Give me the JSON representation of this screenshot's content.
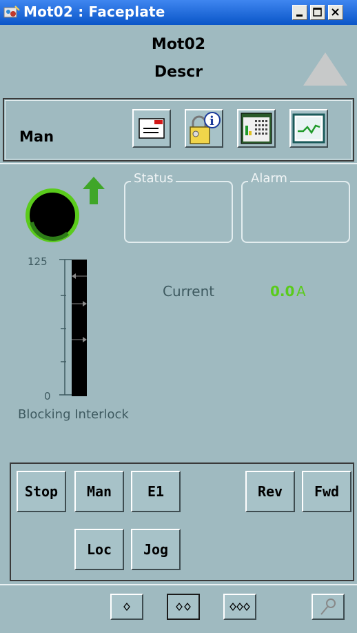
{
  "window": {
    "title": "Mot02 : Faceplate",
    "icons": [
      "app-icon",
      "minimize-icon",
      "maximize-icon",
      "close-icon"
    ]
  },
  "header": {
    "tag": "Mot02",
    "description": "Descr",
    "alarm_indicator_color": "#c7c9c9"
  },
  "toolbar": {
    "mode": "Man",
    "buttons": [
      {
        "name": "message-list-button",
        "icon": "message-icon"
      },
      {
        "name": "info-button",
        "icon": "lock-info-icon"
      },
      {
        "name": "parameters-button",
        "icon": "parameter-view-icon"
      },
      {
        "name": "trend-button",
        "icon": "trend-icon"
      }
    ]
  },
  "status": {
    "motor_color": "#000000",
    "motor_ring_color": "#5acb1c",
    "direction_arrow_color": "#3fa628",
    "status_label": "Status",
    "alarm_label": "Alarm"
  },
  "bar": {
    "max": "125",
    "min": "0",
    "value": 0,
    "interlock_label": "Blocking Interlock"
  },
  "measurement": {
    "label": "Current",
    "value": "0.0",
    "unit": "A",
    "value_color": "#5acb1c"
  },
  "commands": {
    "stop": "Stop",
    "man": "Man",
    "e1": "E1",
    "rev": "Rev",
    "fwd": "Fwd",
    "loc": "Loc",
    "jog": "Jog"
  },
  "footer": {
    "views": [
      "view-1",
      "view-2",
      "view-3"
    ],
    "selected_view": 2,
    "pin_icon": "pin-icon"
  },
  "colors": {
    "background": "#9fbac0",
    "titlebar": "#0a5ed3"
  }
}
